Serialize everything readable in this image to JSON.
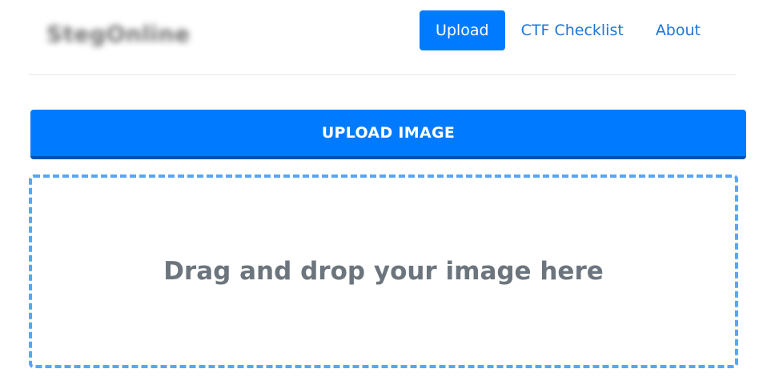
{
  "header": {
    "brand": "StegOnline",
    "nav": [
      {
        "label": "Upload",
        "active": true
      },
      {
        "label": "CTF Checklist",
        "active": false
      },
      {
        "label": "About",
        "active": false
      }
    ]
  },
  "main": {
    "upload_button_label": "UPLOAD IMAGE",
    "dropzone_text": "Drag and drop your image here"
  },
  "colors": {
    "accent": "#007bff",
    "accent_dark": "#0052b0",
    "link": "#1d76d6",
    "dropzone_border": "#5aa5f6",
    "muted_text": "#6c757d"
  }
}
